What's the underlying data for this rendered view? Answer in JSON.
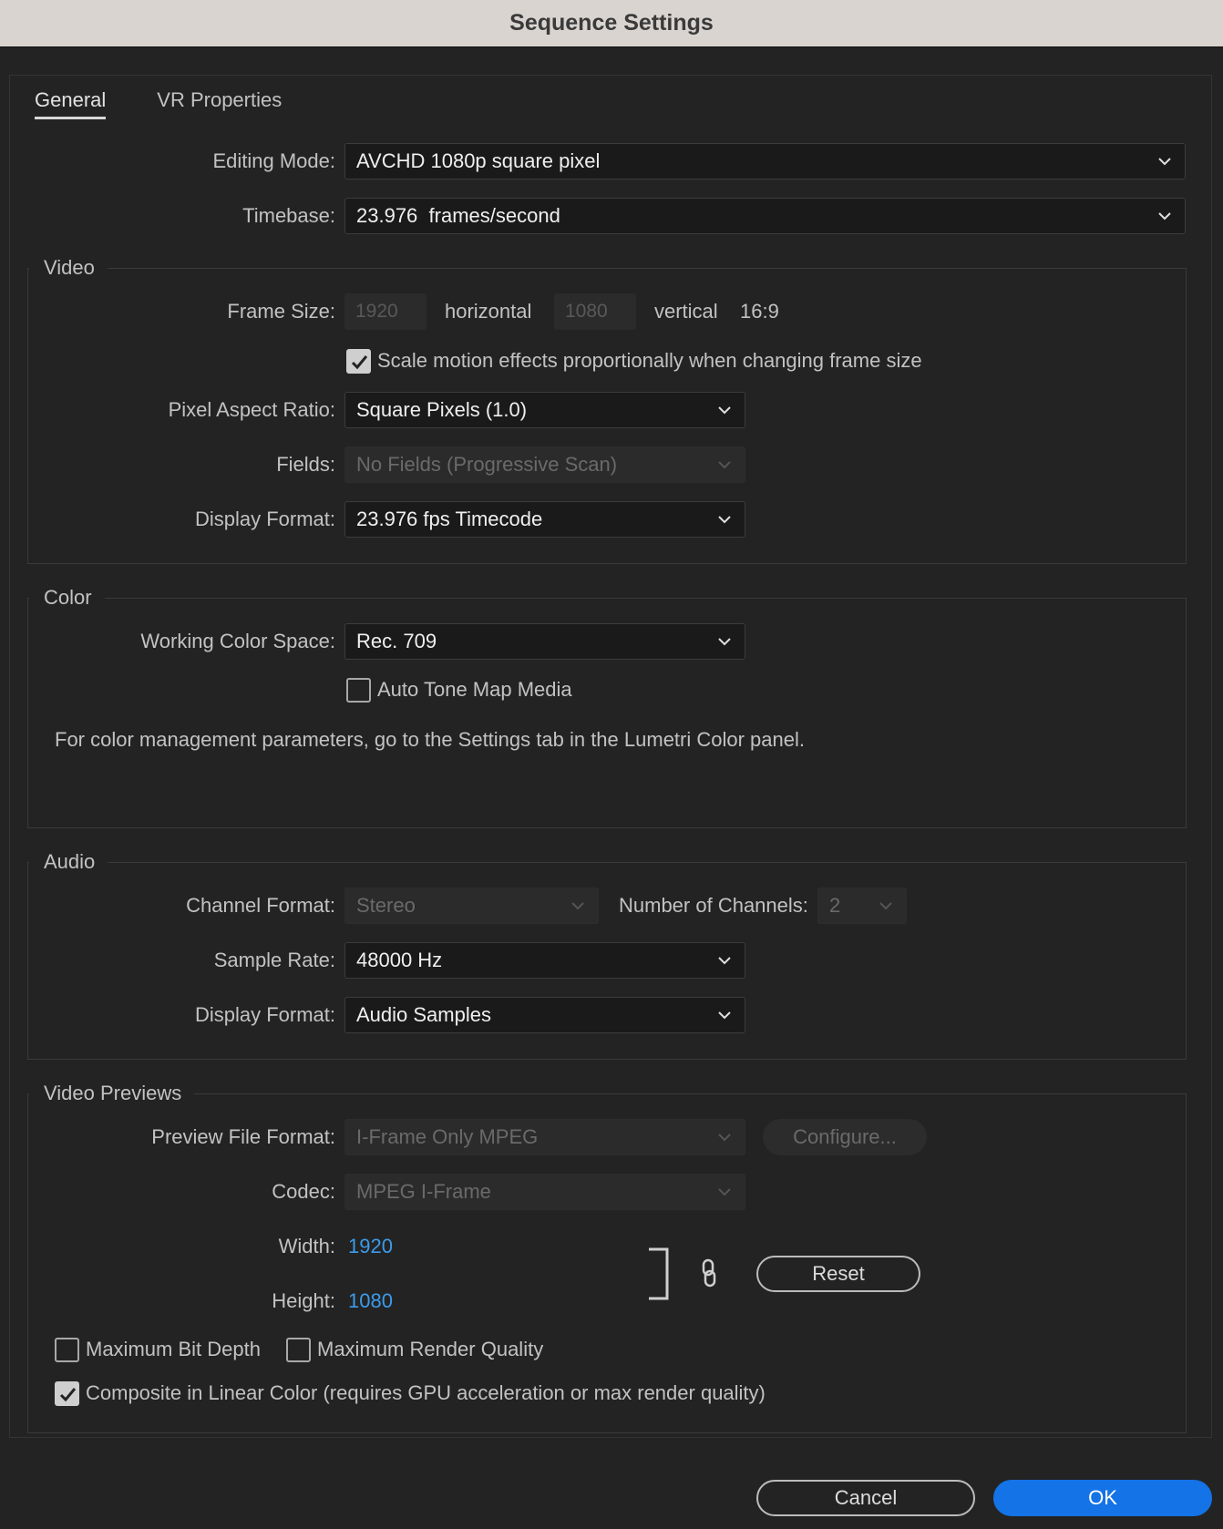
{
  "window": {
    "title": "Sequence Settings"
  },
  "tabs": [
    {
      "label": "General",
      "active": true
    },
    {
      "label": "VR Properties",
      "active": false
    }
  ],
  "general": {
    "editing_mode_label": "Editing Mode:",
    "editing_mode_value": "AVCHD 1080p square pixel",
    "timebase_label": "Timebase:",
    "timebase_value": "23.976  frames/second"
  },
  "video": {
    "section_title": "Video",
    "frame_size_label": "Frame Size:",
    "frame_width": "1920",
    "horizontal_label": "horizontal",
    "frame_height": "1080",
    "vertical_label": "vertical",
    "aspect": "16:9",
    "scale_motion_label": "Scale motion effects proportionally when changing frame size",
    "scale_motion_checked": true,
    "pixel_aspect_label": "Pixel Aspect Ratio:",
    "pixel_aspect_value": "Square Pixels (1.0)",
    "fields_label": "Fields:",
    "fields_value": "No Fields (Progressive Scan)",
    "display_format_label": "Display Format:",
    "display_format_value": "23.976 fps Timecode"
  },
  "color": {
    "section_title": "Color",
    "working_space_label": "Working Color Space:",
    "working_space_value": "Rec. 709",
    "auto_tone_label": "Auto Tone Map Media",
    "auto_tone_checked": false,
    "note": "For color management parameters, go to the Settings tab in the Lumetri Color panel."
  },
  "audio": {
    "section_title": "Audio",
    "channel_format_label": "Channel Format:",
    "channel_format_value": "Stereo",
    "num_channels_label": "Number of Channels:",
    "num_channels_value": "2",
    "sample_rate_label": "Sample Rate:",
    "sample_rate_value": "48000 Hz",
    "display_format_label": "Display Format:",
    "display_format_value": "Audio Samples"
  },
  "previews": {
    "section_title": "Video Previews",
    "file_format_label": "Preview File Format:",
    "file_format_value": "I-Frame Only MPEG",
    "configure_label": "Configure...",
    "codec_label": "Codec:",
    "codec_value": "MPEG I-Frame",
    "width_label": "Width:",
    "width_value": "1920",
    "height_label": "Height:",
    "height_value": "1080",
    "reset_label": "Reset",
    "max_bit_depth_label": "Maximum Bit Depth",
    "max_bit_depth_checked": false,
    "max_render_label": "Maximum Render Quality",
    "max_render_checked": false,
    "linear_color_label": "Composite in Linear Color (requires GPU acceleration or max render quality)",
    "linear_color_checked": true
  },
  "footer": {
    "cancel_label": "Cancel",
    "ok_label": "OK"
  },
  "colors": {
    "accent": "#1473e6",
    "link": "#3d9bec",
    "background": "#232323"
  }
}
